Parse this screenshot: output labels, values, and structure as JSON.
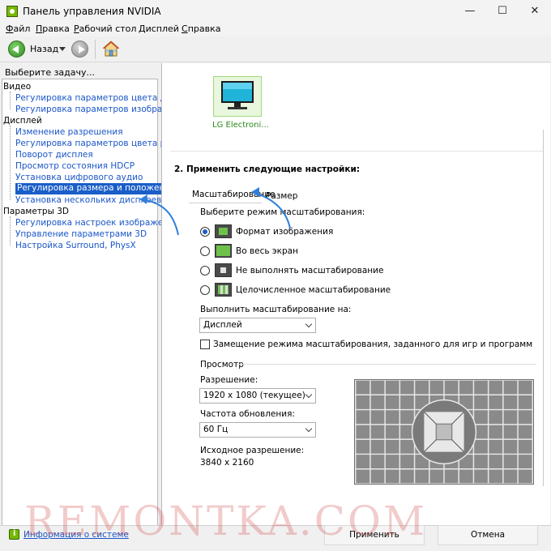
{
  "window": {
    "title": "Панель управления NVIDIA",
    "minimize_glyph": "—",
    "maximize_glyph": "☐",
    "close_glyph": "✕"
  },
  "menu": {
    "items": [
      {
        "label": "Файл",
        "u": "Ф",
        "rest": "айл"
      },
      {
        "label": "Правка",
        "u": "П",
        "rest": "равка"
      },
      {
        "label": "Рабочий стол",
        "u": "Р",
        "rest": "абочий стол"
      },
      {
        "label": "Дисплей",
        "u": "Д",
        "rest": "исплей"
      },
      {
        "label": "Справка",
        "u": "С",
        "rest": "правка"
      }
    ]
  },
  "toolbar": {
    "back_label": "Назад"
  },
  "sidebar": {
    "task_label": "Выберите задачу...",
    "categories": [
      {
        "label": "Видео"
      },
      {
        "label": "Дисплей"
      },
      {
        "label": "Параметры 3D"
      }
    ],
    "video_items": [
      "Регулировка параметров цвета для видео",
      "Регулировка параметров изображения для видео"
    ],
    "display_items": [
      "Изменение разрешения",
      "Регулировка параметров цвета рабочего стола",
      "Поворот дисплея",
      "Просмотр состояния HDCP",
      "Установка цифрового аудио",
      "Регулировка размера и положения рабочего стола",
      "Установка нескольких дисплеев"
    ],
    "three_d_items": [
      "Регулировка настроек изображения с просмотром",
      "Управление параметрами 3D",
      "Настройка Surround, PhysX"
    ],
    "selected_index": 5,
    "system_info_link": "Информация о системе"
  },
  "content": {
    "monitor_label": "LG Electroni...",
    "section_title": "2. Применить следующие настройки:",
    "tabs": [
      {
        "label": "Масштабирование",
        "active": true
      },
      {
        "label": "Размер",
        "active": false
      }
    ],
    "scaling_mode_label": "Выберите режим масштабирования:",
    "modes": [
      {
        "label": "Формат изображения",
        "selected": true
      },
      {
        "label": "Во весь экран",
        "selected": false
      },
      {
        "label": "Не выполнять масштабирование",
        "selected": false
      },
      {
        "label": "Целочисленное масштабирование",
        "selected": false
      }
    ],
    "perform_on_label": "Выполнить масштабирование на:",
    "perform_on_value": "Дисплей",
    "override_checkbox_label": "Замещение режима масштабирования, заданного для игр и программ",
    "override_checked": false,
    "preview_label": "Просмотр",
    "resolution_label": "Разрешение:",
    "resolution_value": "1920 x 1080 (текущее)",
    "refresh_label": "Частота обновления:",
    "refresh_value": "60 Гц",
    "native_label": "Исходное разрешение:",
    "native_value": "3840 x 2160"
  },
  "buttons": {
    "apply": "Применить",
    "cancel": "Отмена"
  },
  "watermark": "REMONTKA.COM",
  "colors": {
    "accent": "#1a5ec8",
    "nvidia_green": "#76b900",
    "annotation_arrow": "#2f7fd8"
  }
}
